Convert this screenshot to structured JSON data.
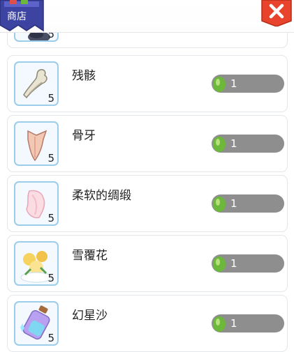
{
  "header": {
    "shop_label": "商店"
  },
  "items": [
    {
      "name": "",
      "qty": "5",
      "price": "",
      "icon": "dark-item-icon"
    },
    {
      "name": "残骸",
      "qty": "5",
      "price": "1",
      "icon": "debris-icon"
    },
    {
      "name": "骨牙",
      "qty": "5",
      "price": "1",
      "icon": "bone-fang-icon"
    },
    {
      "name": "柔软的绸缎",
      "qty": "5",
      "price": "1",
      "icon": "silk-icon"
    },
    {
      "name": "雪覆花",
      "qty": "5",
      "price": "1",
      "icon": "snow-flower-icon"
    },
    {
      "name": "幻星沙",
      "qty": "5",
      "price": "1",
      "icon": "star-sand-icon"
    }
  ],
  "colors": {
    "accent_red": "#e8432c",
    "thumb_border": "#9ccdea",
    "price_pill": "#8e8e8e",
    "gem_green": "#6cb83a"
  }
}
